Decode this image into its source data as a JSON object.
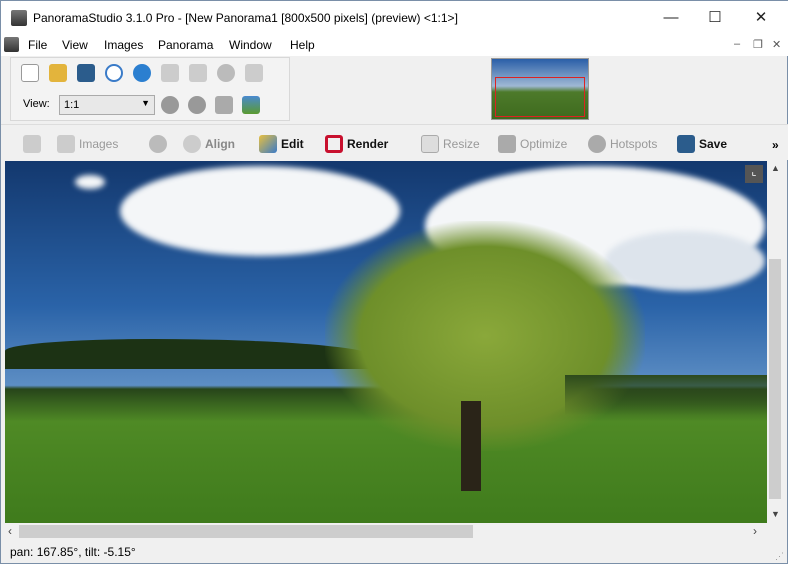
{
  "window": {
    "title": "PanoramaStudio 3.1.0 Pro - [New Panorama1 [800x500 pixels] (preview) <1:1>]",
    "minimize": "—",
    "maximize": "☐",
    "close": "✕"
  },
  "menu": [
    "File",
    "View",
    "Images",
    "Panorama",
    "Window",
    "Help"
  ],
  "toolbar": {
    "view_label": "View:",
    "view_value": "1:1"
  },
  "toolbar2": [
    {
      "label": "Images",
      "enabled": false
    },
    {
      "label": "Align",
      "enabled": false
    },
    {
      "label": "Edit",
      "enabled": true
    },
    {
      "label": "Render",
      "enabled": true
    },
    {
      "label": "Resize",
      "enabled": false
    },
    {
      "label": "Optimize",
      "enabled": false
    },
    {
      "label": "Hotspots",
      "enabled": false
    },
    {
      "label": "Save",
      "enabled": true
    }
  ],
  "overflow": "»",
  "status": {
    "text": "pan: 167.85°, tilt: -5.15°"
  },
  "colors": {
    "render": "#c8102e",
    "sky": "#2a63a8",
    "grass": "#4f8a25"
  }
}
